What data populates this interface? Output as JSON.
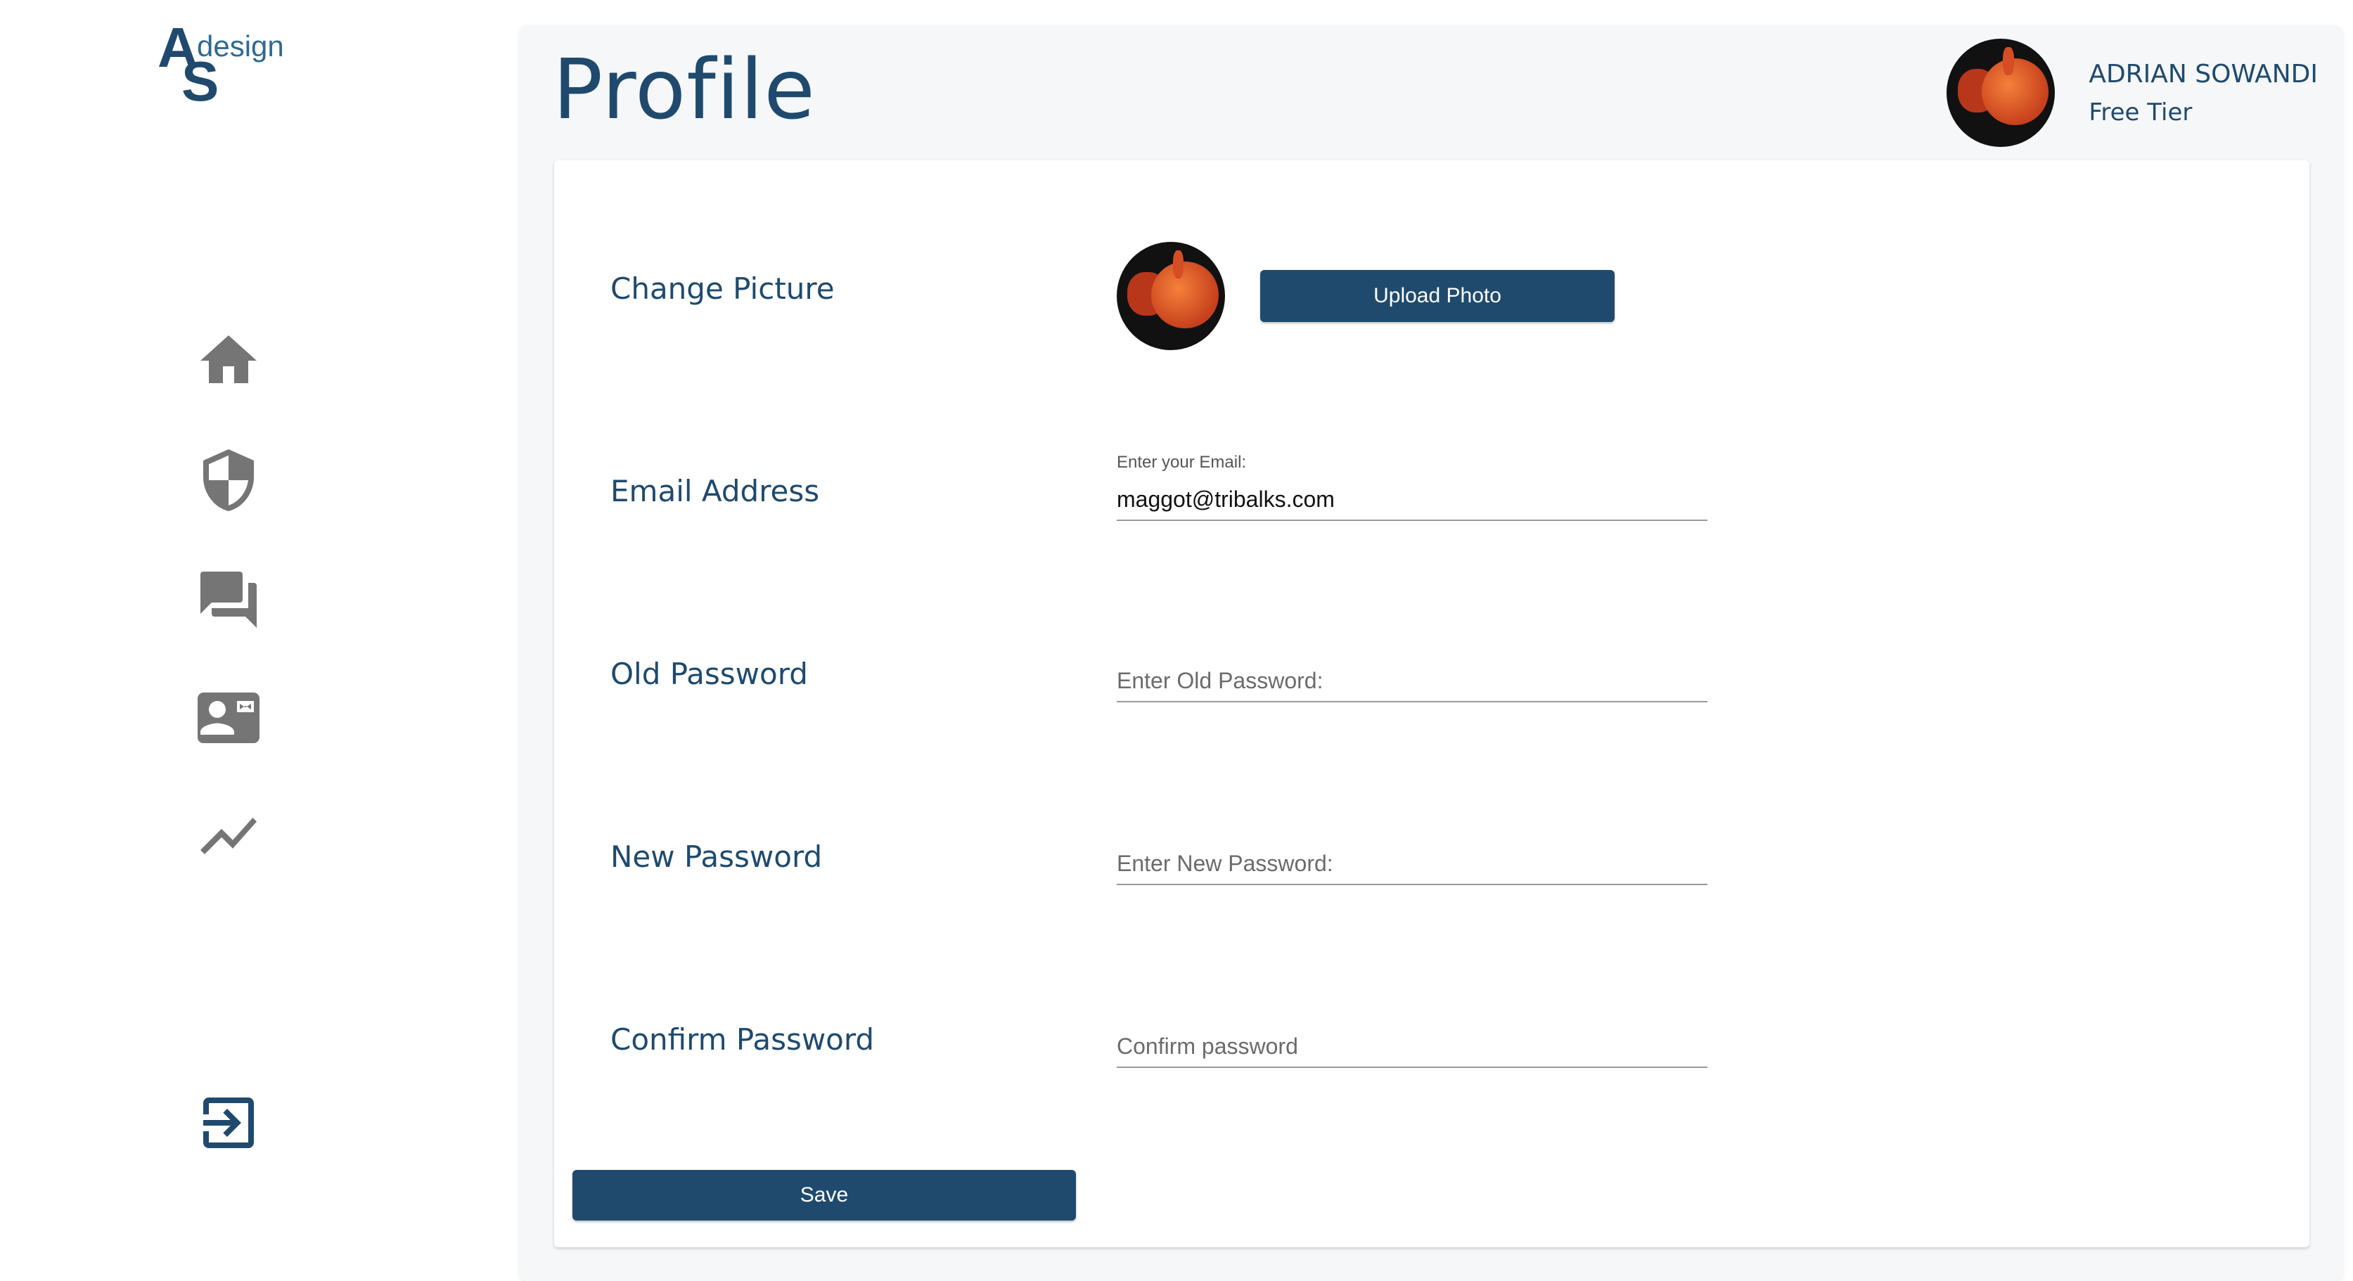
{
  "brand": {
    "logo_letters": [
      "A",
      "S"
    ],
    "logo_word": "design"
  },
  "sidebar": {
    "items": [
      {
        "icon": "home-icon"
      },
      {
        "icon": "shield-icon"
      },
      {
        "icon": "chat-icon"
      },
      {
        "icon": "contact-card-icon"
      },
      {
        "icon": "trending-icon"
      }
    ],
    "logout_icon": "logout-icon"
  },
  "header": {
    "title": "Profile",
    "user_name": "ADRIAN SOWANDI",
    "user_tier": "Free Tier"
  },
  "form": {
    "change_picture_label": "Change Picture",
    "upload_label": "Upload Photo",
    "email_label": "Email Address",
    "email_small_label": "Enter your Email:",
    "email_value": "maggot@tribalks.com",
    "old_password_label": "Old Password",
    "old_password_placeholder": "Enter Old Password:",
    "new_password_label": "New Password",
    "new_password_placeholder": "Enter New Password:",
    "confirm_password_label": "Confirm Password",
    "confirm_password_placeholder": "Confirm password",
    "save_label": "Save"
  },
  "colors": {
    "primary": "#1f4a6e",
    "icon_gray": "#757575",
    "panel_bg": "#f6f7f8"
  }
}
